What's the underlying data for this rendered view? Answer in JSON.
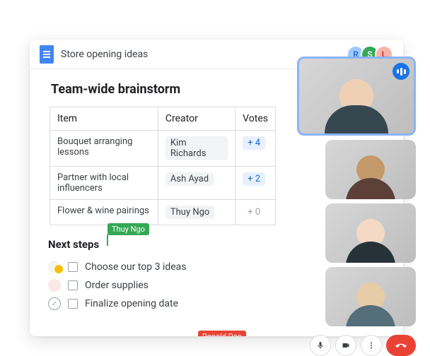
{
  "header": {
    "doc_title": "Store opening ideas",
    "collaborators": [
      {
        "initial": "R",
        "bg": "#a0c8ff",
        "fg": "#1967d2"
      },
      {
        "initial": "S",
        "bg": "#34a853",
        "fg": "#ffffff"
      },
      {
        "initial": "L",
        "bg": "#f7b4ab",
        "fg": "#c5221f"
      }
    ]
  },
  "brainstorm": {
    "title": "Team-wide brainstorm",
    "columns": {
      "item": "Item",
      "creator": "Creator",
      "votes": "Votes"
    },
    "rows": [
      {
        "item": "Bouquet arranging lessons",
        "creator": "Kim Richards",
        "votes_label": "+ 4",
        "style": "pos"
      },
      {
        "item": "Partner with local influencers",
        "creator": "Ash Ayad",
        "votes_label": "+ 2",
        "style": "pos"
      },
      {
        "item": "Flower & wine pairings",
        "creator": "Thuy Ngo",
        "votes_label": "+ 0",
        "style": "zero"
      }
    ]
  },
  "cursors": {
    "green": "Thuy Ngo",
    "red": "Ronald Das"
  },
  "next_steps": {
    "title": "Next steps",
    "tasks": [
      {
        "label": "Choose our top 3 ideas",
        "icon": "double"
      },
      {
        "label": "Order supplies",
        "icon": "single"
      },
      {
        "label": "Finalize opening date",
        "icon": "check"
      }
    ]
  },
  "meet": {
    "mic_icon": "mic-icon",
    "cam_icon": "camera-icon",
    "more_icon": "more-icon",
    "hangup_icon": "hangup-icon"
  }
}
